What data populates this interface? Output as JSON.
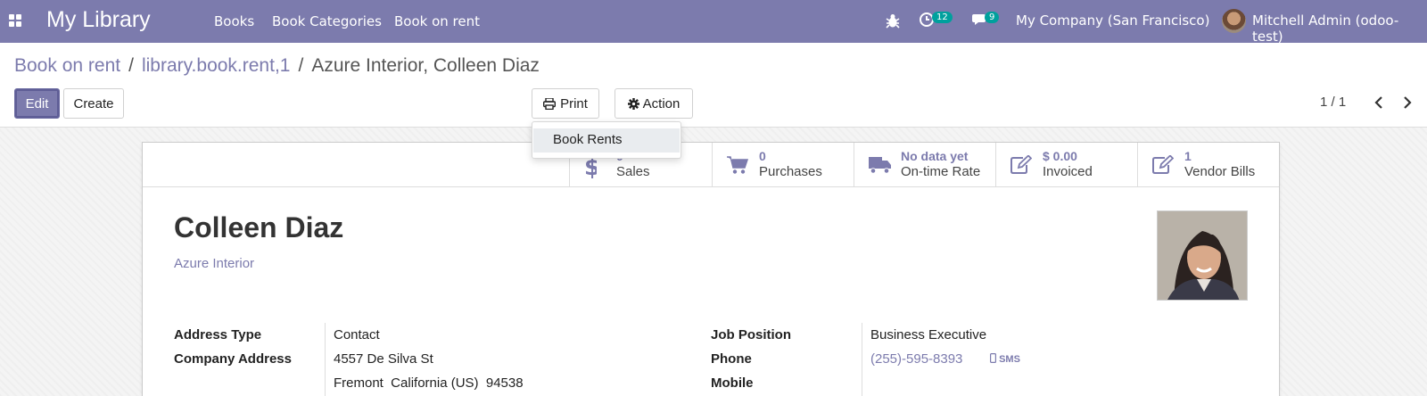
{
  "navbar": {
    "app_title": "My Library",
    "menus": [
      "Books",
      "Book Categories",
      "Book on rent"
    ],
    "activity_count": "12",
    "message_count": "9",
    "company": "My Company (San Francisco)",
    "user": "Mitchell Admin (odoo-test)",
    "color": "#7c7bad",
    "badge_color": "#00a09d"
  },
  "breadcrumb": {
    "items": [
      "Book on rent",
      "library.book.rent,1"
    ],
    "current": "Azure Interior, Colleen Diaz"
  },
  "toolbar": {
    "edit_label": "Edit",
    "create_label": "Create",
    "print_label": "Print",
    "action_label": "Action",
    "pager": "1 / 1"
  },
  "print_menu": {
    "items": [
      "Book Rents"
    ]
  },
  "smart_buttons": [
    {
      "value": "0",
      "label": "Sales",
      "icon": "dollar-icon"
    },
    {
      "value": "0",
      "label": "Purchases",
      "icon": "cart-icon"
    },
    {
      "value": "No data yet",
      "label": "On-time Rate",
      "icon": "truck-icon"
    },
    {
      "value": "$ 0.00",
      "label": "Invoiced",
      "icon": "pencil-square-icon"
    },
    {
      "value": "1",
      "label": "Vendor Bills",
      "icon": "pencil-square-icon"
    }
  ],
  "partner": {
    "name": "Colleen Diaz",
    "company": "Azure Interior"
  },
  "fields": {
    "address_type_label": "Address Type",
    "address_type": "Contact",
    "company_address_label": "Company Address",
    "street": "4557 De Silva St",
    "city_line": "Fremont  California (US)  94538",
    "job_position_label": "Job Position",
    "job_position": "Business Executive",
    "phone_label": "Phone",
    "phone": "(255)-595-8393",
    "sms_label": "SMS",
    "mobile_label": "Mobile"
  }
}
